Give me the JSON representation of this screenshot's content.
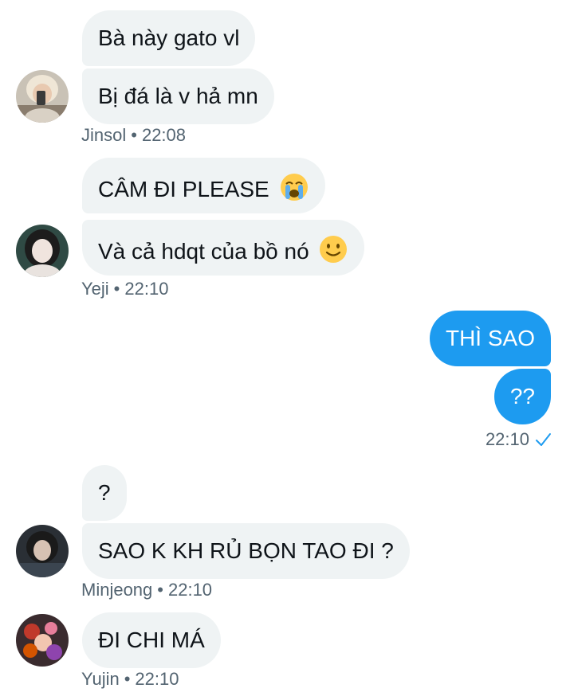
{
  "conversation": [
    {
      "sender": "Jinsol",
      "time": "22:08",
      "messages": [
        "Bà này gato vl",
        "Bị đá là v hả mn"
      ]
    },
    {
      "sender": "Yeji",
      "time": "22:10",
      "messages": [
        "CÂM ĐI PLEASE",
        "Và cả hdqt của bồ nó"
      ]
    },
    {
      "sender": "me",
      "time": "22:10",
      "messages": [
        "THÌ SAO",
        "??"
      ]
    },
    {
      "sender": "Minjeong",
      "time": "22:10",
      "messages": [
        "?",
        "SAO K KH RỦ BỌN TAO ĐI ?"
      ]
    },
    {
      "sender": "Yujin",
      "time": "22:10",
      "messages": [
        "ĐI CHI MÁ"
      ]
    }
  ],
  "icons": {
    "crying_emoji": "loudly-crying-face-emoji",
    "smile_emoji": "slightly-smiling-face-emoji",
    "read_receipt": "checkmark-icon"
  },
  "colors": {
    "incoming_bubble": "#eff3f4",
    "outgoing_bubble": "#1d9bf0",
    "meta_text": "#536471",
    "check": "#1d9bf0"
  }
}
